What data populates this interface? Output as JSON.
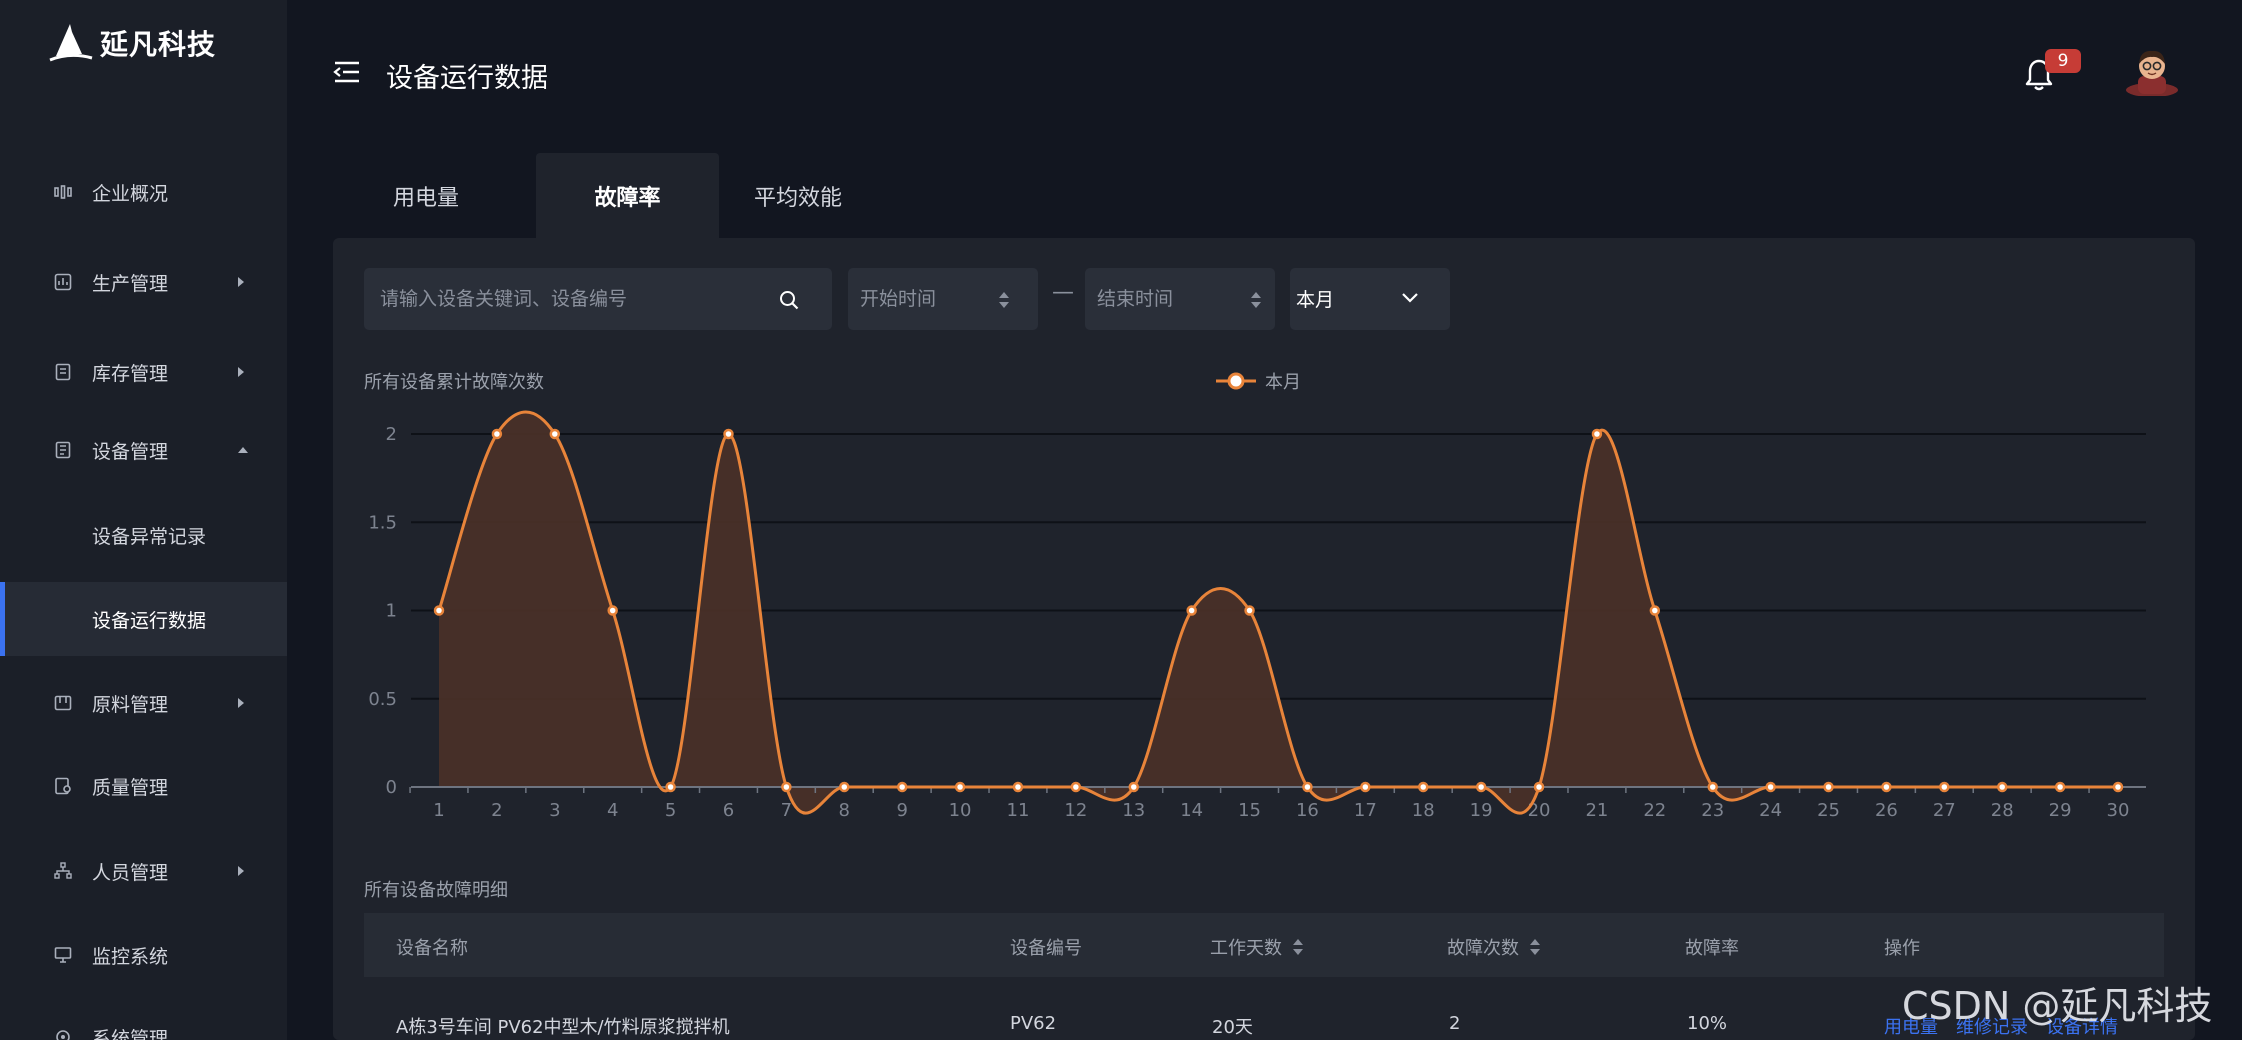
{
  "brand": {
    "name": "延凡科技"
  },
  "sidebar": {
    "items": [
      {
        "label": "企业概况"
      },
      {
        "label": "生产管理"
      },
      {
        "label": "库存管理"
      },
      {
        "label": "设备管理"
      },
      {
        "label": "设备异常记录"
      },
      {
        "label": "设备运行数据"
      },
      {
        "label": "原料管理"
      },
      {
        "label": "质量管理"
      },
      {
        "label": "人员管理"
      },
      {
        "label": "监控系统"
      },
      {
        "label": "系统管理"
      }
    ]
  },
  "header": {
    "title": "设备运行数据",
    "notification_count": "9"
  },
  "tabs": [
    {
      "label": "用电量"
    },
    {
      "label": "故障率"
    },
    {
      "label": "平均效能"
    }
  ],
  "filters": {
    "search_placeholder": "请输入设备关键词、设备编号",
    "start_placeholder": "开始时间",
    "separator": "—",
    "end_placeholder": "结束时间",
    "period_value": "本月"
  },
  "chart_section_title": "所有设备累计故障次数",
  "chart_data": {
    "type": "area",
    "x": [
      1,
      2,
      3,
      4,
      5,
      6,
      7,
      8,
      9,
      10,
      11,
      12,
      13,
      14,
      15,
      16,
      17,
      18,
      19,
      20,
      21,
      22,
      23,
      24,
      25,
      26,
      27,
      28,
      29,
      30
    ],
    "series": [
      {
        "name": "本月",
        "values": [
          1,
          2,
          2,
          1,
          0,
          2,
          0,
          0,
          0,
          0,
          0,
          0,
          0,
          1,
          1,
          0,
          0,
          0,
          0,
          0,
          2,
          1,
          0,
          0,
          0,
          0,
          0,
          0,
          0,
          0
        ]
      }
    ],
    "ylim": [
      0,
      2
    ],
    "yticks": [
      "0",
      "0.5",
      "1",
      "1.5",
      "2"
    ],
    "xticks": [
      "1",
      "2",
      "3",
      "4",
      "5",
      "6",
      "7",
      "8",
      "9",
      "10",
      "11",
      "12",
      "13",
      "14",
      "15",
      "16",
      "17",
      "18",
      "19",
      "20",
      "21",
      "22",
      "23",
      "24",
      "25",
      "26",
      "27",
      "28",
      "29",
      "30"
    ],
    "grid": true,
    "legend": "top-center",
    "colors": {
      "line": "#e8843a",
      "fill": "#4a3128"
    }
  },
  "table_section_title": "所有设备故障明细",
  "table": {
    "columns": [
      "设备名称",
      "设备编号",
      "工作天数",
      "故障次数",
      "故障率",
      "操作"
    ],
    "rows": [
      {
        "name": "A栋3号车间  PV62中型木/竹料原浆搅拌机",
        "code": "PV62",
        "days": "20天",
        "faults": "2",
        "rate": "10%",
        "actions": [
          "用电量",
          "维修记录",
          "设备详情"
        ]
      }
    ]
  },
  "watermark": "CSDN @延凡科技"
}
